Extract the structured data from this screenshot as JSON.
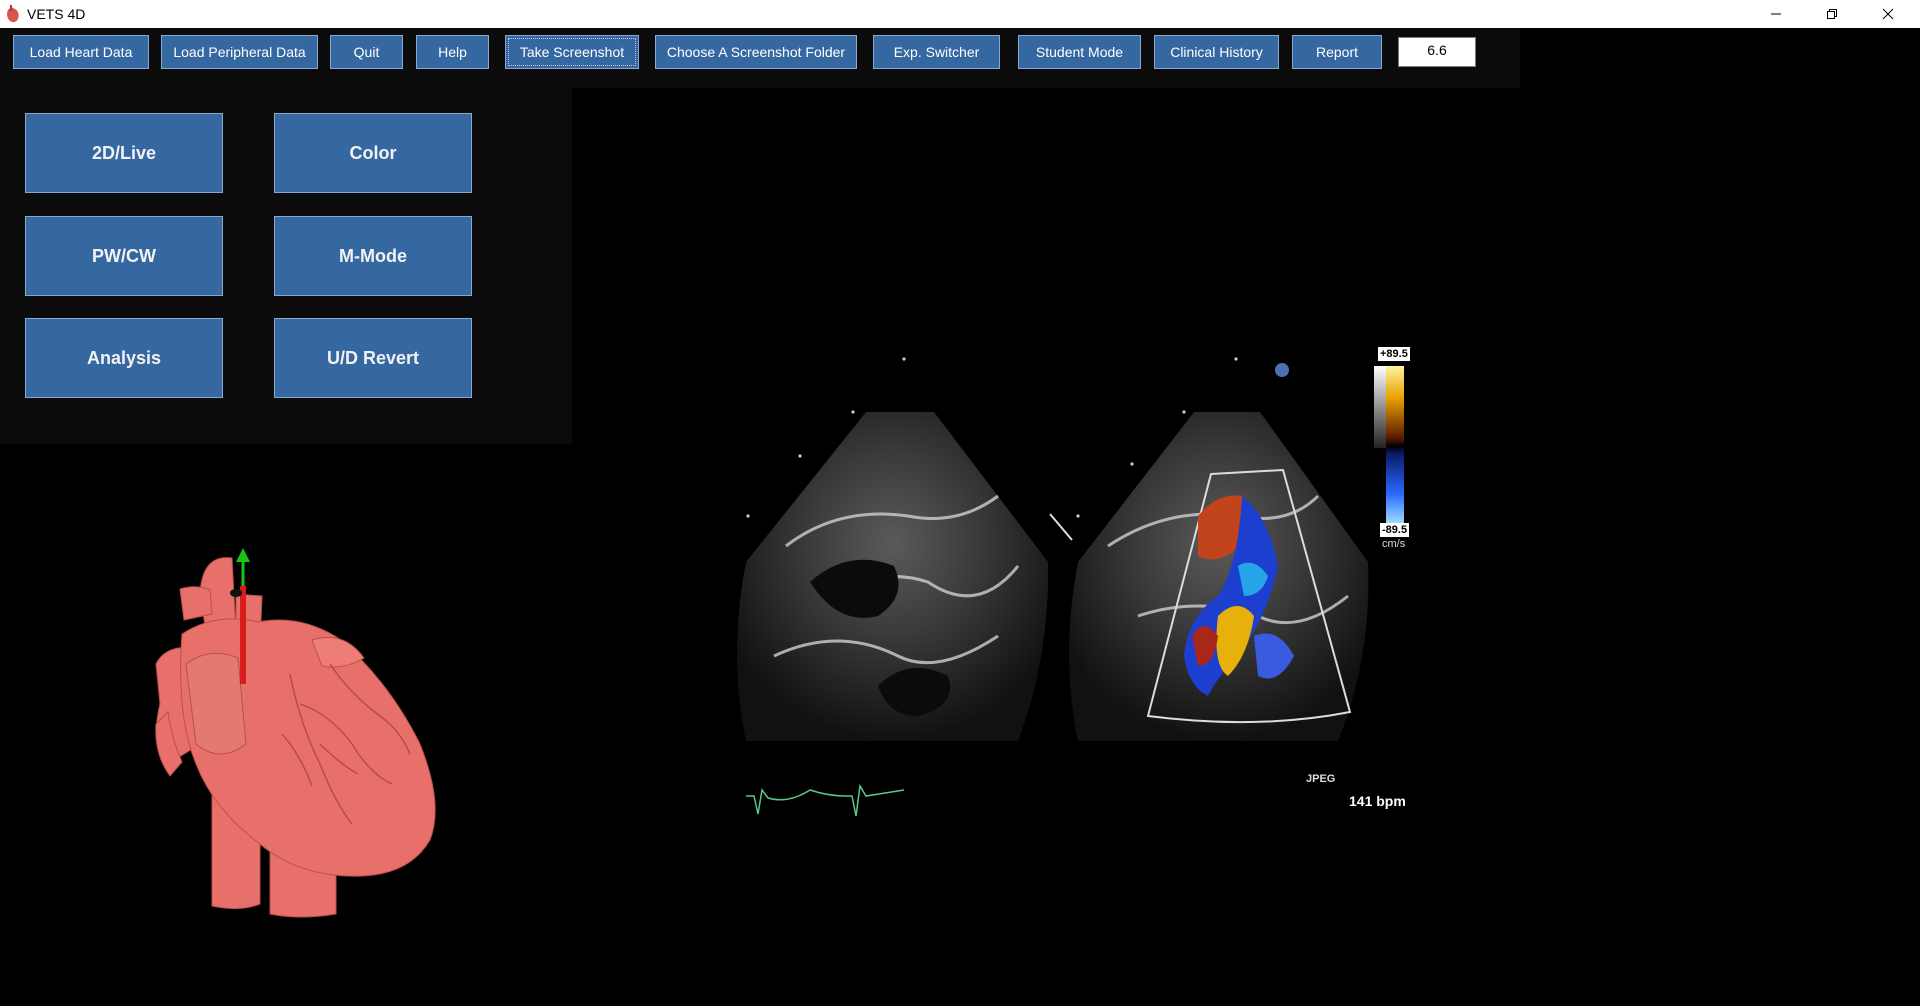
{
  "window": {
    "title": "VETS 4D",
    "icon": "heart-app-icon",
    "controls": [
      "minimize-icon",
      "restore-icon",
      "close-icon"
    ]
  },
  "toolbar": {
    "load_heart": "Load Heart Data",
    "load_peripheral": "Load Peripheral Data",
    "quit": "Quit",
    "help": "Help",
    "take_screenshot": "Take Screenshot",
    "choose_folder": "Choose A Screenshot Folder",
    "exp_switcher": "Exp. Switcher",
    "student_mode": "Student Mode",
    "clinical_history": "Clinical History",
    "report": "Report",
    "value_box": "6.6"
  },
  "modes": {
    "live2d": "2D/Live",
    "color": "Color",
    "pwcw": "PW/CW",
    "mmode": "M-Mode",
    "analysis": "Analysis",
    "ud_revert": "U/D Revert"
  },
  "echo": {
    "heart_rate": "141 bpm",
    "format": "JPEG",
    "scale_top": "+89.5",
    "scale_bottom": "-89.5",
    "scale_unit": "cm/s"
  },
  "colors": {
    "button_fill": "#3567a0",
    "button_border": "#8aa8cf",
    "heart_model": "#e8706a",
    "ecg_trace": "#59c98a"
  }
}
